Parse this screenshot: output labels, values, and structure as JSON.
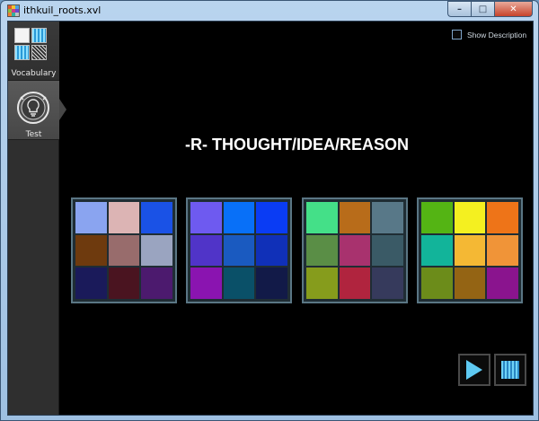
{
  "window": {
    "title": "ithkuil_roots.xvl",
    "min_symbol": "–",
    "max_symbol": "□",
    "close_symbol": "✕"
  },
  "sidebar": {
    "items": [
      {
        "label": "Vocabulary",
        "icon": "vocabulary-grid-icon"
      },
      {
        "label": "Test",
        "icon": "lightbulb-icon"
      }
    ]
  },
  "options": {
    "show_description_label": "Show Description",
    "show_description_checked": false
  },
  "word": {
    "title": "-R- THOUGHT/IDEA/REASON"
  },
  "tiles": [
    {
      "colors": [
        "#8aa4f0",
        "#dcb4b4",
        "#1a52e6",
        "#6e3a0e",
        "#986c6c",
        "#9aa4c0",
        "#1a1a5a",
        "#4a1420",
        "#4c1a6e"
      ]
    },
    {
      "colors": [
        "#6e5af0",
        "#0870f8",
        "#0a3cf4",
        "#5034c8",
        "#1a5ac0",
        "#1030b8",
        "#8a14b0",
        "#0a5068",
        "#121a48"
      ]
    },
    {
      "colors": [
        "#44e088",
        "#b86c1a",
        "#587888",
        "#5a8e46",
        "#a8326e",
        "#3a5a66",
        "#869c1c",
        "#b0243e",
        "#363a5c"
      ]
    },
    {
      "colors": [
        "#54b414",
        "#f4f020",
        "#ee7418",
        "#12b49a",
        "#f4b834",
        "#f09438",
        "#6c8c1a",
        "#946414",
        "#8a148e"
      ]
    }
  ],
  "controls": {
    "play_icon": "play-icon",
    "stop_icon": "stop-icon",
    "accent": "#5ec9f2"
  }
}
